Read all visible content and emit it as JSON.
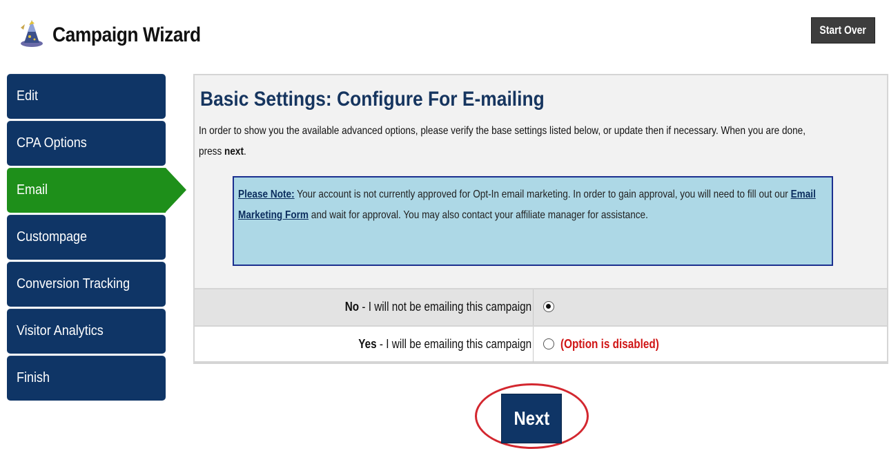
{
  "header": {
    "title": "Campaign Wizard",
    "logo_icon": "wizard-hat-icon",
    "start_over_label": "Start Over"
  },
  "sidebar": {
    "items": [
      {
        "label": "Edit"
      },
      {
        "label": "CPA Options"
      },
      {
        "label": "Email",
        "active": true
      },
      {
        "label": "Custompage"
      },
      {
        "label": "Conversion Tracking"
      },
      {
        "label": "Visitor Analytics"
      },
      {
        "label": "Finish"
      }
    ]
  },
  "main": {
    "title": "Basic Settings: Configure For E-mailing",
    "desc_prefix": "In order to show you the available advanced options, please verify the base settings listed below, or update then if necessary. When you are done, press ",
    "desc_bold": "next",
    "desc_suffix": ".",
    "note": {
      "lead": "Please Note:",
      "text1": " Your account is not currently approved for Opt-In email marketing. In order to gain approval, you will need to fill out our ",
      "link": "Email Marketing Form",
      "text2": " and wait for approval. You may also contact your affiliate manager for assistance."
    },
    "options": [
      {
        "bold": "No",
        "text": " - I will not be emailing this campaign",
        "checked": true
      },
      {
        "bold": "Yes",
        "text": " - I will be emailing this campaign",
        "checked": false,
        "note": "(Option is disabled)"
      }
    ]
  },
  "next_label": "Next",
  "colors": {
    "nav_bg": "#0f3566",
    "nav_active": "#1e8f1a",
    "title": "#16355f",
    "note_bg": "#add8e6",
    "note_border": "#1b2f8f",
    "disabled_text": "#d01616",
    "highlight_ring": "#d3272f"
  }
}
